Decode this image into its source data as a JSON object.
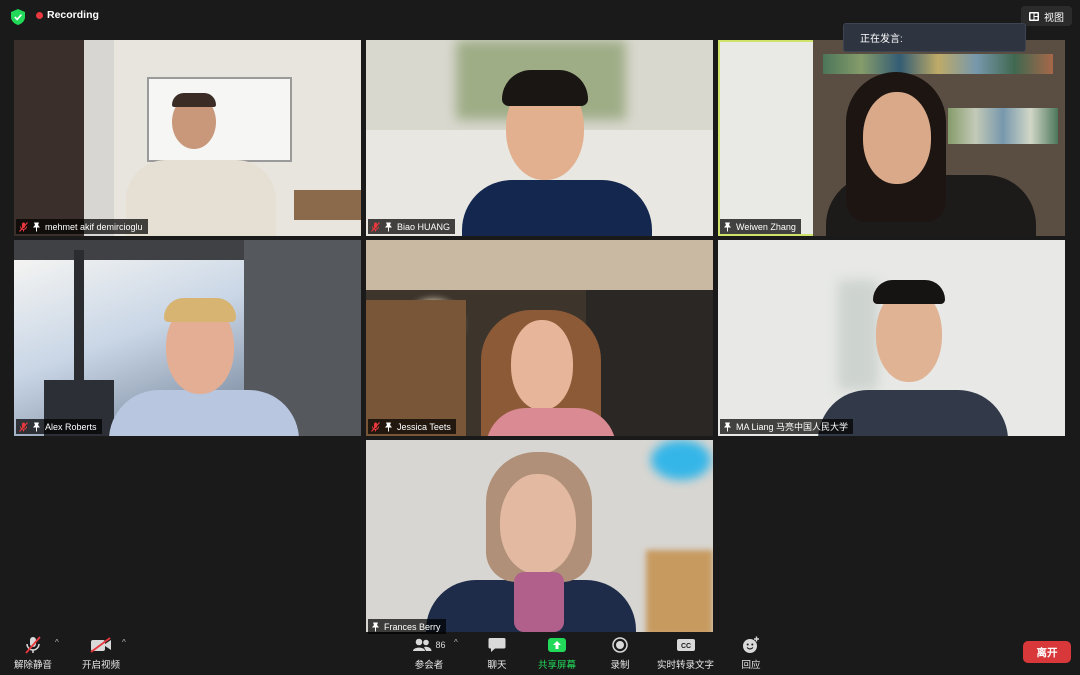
{
  "window": {
    "recording_label": "Recording",
    "view_label": "视图",
    "active_speaker_label": "正在发言:"
  },
  "participants": [
    {
      "name": "mehmet akif demircioglu",
      "muted": true
    },
    {
      "name": "Biao HUANG",
      "muted": true
    },
    {
      "name": "Weiwen Zhang",
      "muted": false,
      "active_speaker": true
    },
    {
      "name": "Alex Roberts",
      "muted": true
    },
    {
      "name": "Jessica Teets",
      "muted": true
    },
    {
      "name": "MA Liang 马亮中国人民大学",
      "muted": false
    },
    {
      "name": "Frances Berry",
      "muted": false
    }
  ],
  "toolbar": {
    "unmute_label": "解除静音",
    "start_video_label": "开启视频",
    "participants_label": "参会者",
    "participants_count": "86",
    "chat_label": "聊天",
    "share_label": "共享屏幕",
    "record_label": "录制",
    "captions_label": "实时转录文字",
    "reactions_label": "回应",
    "leave_label": "离开"
  },
  "colors": {
    "background": "#1a1a1a",
    "recording_dot": "#e8383d",
    "share_green": "#23d959",
    "leave_red": "#d9383a",
    "active_border": "#cfe36a",
    "security_green": "#23d959"
  }
}
